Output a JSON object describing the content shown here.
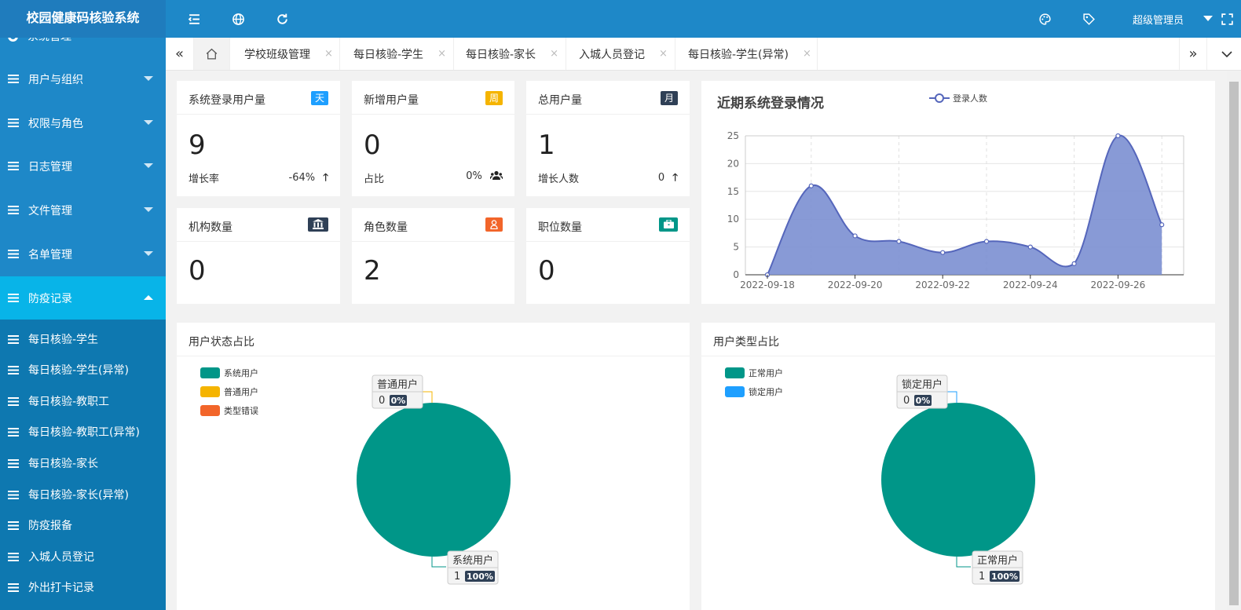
{
  "app": {
    "title": "校园健康码核验系统",
    "admin": "超级管理员"
  },
  "topbar_icons": [
    "menu-fold-icon",
    "globe-icon",
    "refresh-icon",
    "palette-icon",
    "tag-icon",
    "fullscreen-icon"
  ],
  "sidebar": {
    "partial_top": "系统管理",
    "items": [
      {
        "label": "用户与组织"
      },
      {
        "label": "权限与角色"
      },
      {
        "label": "日志管理"
      },
      {
        "label": "文件管理"
      },
      {
        "label": "名单管理"
      },
      {
        "label": "防疫记录",
        "active": true
      }
    ],
    "subitems": [
      {
        "label": "每日核验-学生"
      },
      {
        "label": "每日核验-学生(异常)"
      },
      {
        "label": "每日核验-教职工"
      },
      {
        "label": "每日核验-教职工(异常)"
      },
      {
        "label": "每日核验-家长"
      },
      {
        "label": "每日核验-家长(异常)"
      },
      {
        "label": "防疫报备"
      },
      {
        "label": "入城人员登记"
      },
      {
        "label": "外出打卡记录"
      }
    ]
  },
  "tabs": [
    {
      "label": "学校班级管理"
    },
    {
      "label": "每日核验-学生"
    },
    {
      "label": "每日核验-家长"
    },
    {
      "label": "入城人员登记"
    },
    {
      "label": "每日核验-学生(异常)"
    }
  ],
  "tab_close": "×",
  "stats": [
    {
      "title": "系统登录用户量",
      "badge": "天",
      "badge_color": "#1e9fff",
      "value": "9",
      "foot_label": "增长率",
      "foot_value": "-64%",
      "foot_icon": "arrow-up-icon"
    },
    {
      "title": "新增用户量",
      "badge": "周",
      "badge_color": "#f5b400",
      "value": "0",
      "foot_label": "占比",
      "foot_value": "0%",
      "foot_icon": "users-icon"
    },
    {
      "title": "总用户量",
      "badge": "月",
      "badge_color": "#2f4056",
      "value": "1",
      "foot_label": "增长人数",
      "foot_value": "0",
      "foot_icon": "arrow-up-icon"
    },
    {
      "title": "机构数量",
      "badge_icon": "bank-icon",
      "badge_color": "#2f4056",
      "value": "0"
    },
    {
      "title": "角色数量",
      "badge_icon": "user-icon",
      "badge_color": "#f2652a",
      "value": "2"
    },
    {
      "title": "职位数量",
      "badge_icon": "briefcase-icon",
      "badge_color": "#009688",
      "value": "0"
    }
  ],
  "colors": {
    "topbar": "#1e88c8",
    "sidebar_active": "#08b4e8",
    "teal": "#009688",
    "area": "#7b8fd1",
    "line": "#5566bb"
  },
  "line_chart": {
    "title": "近期系统登录情况",
    "chart_data": {
      "type": "area",
      "series": [
        {
          "name": "登录人数",
          "x": [
            "2022-09-18",
            "2022-09-19",
            "2022-09-20",
            "2022-09-21",
            "2022-09-22",
            "2022-09-23",
            "2022-09-24",
            "2022-09-25",
            "2022-09-26",
            "2022-09-27"
          ],
          "values": [
            0,
            16,
            7,
            6,
            4,
            6,
            5,
            2,
            25,
            9
          ]
        }
      ],
      "xticks": [
        "2022-09-18",
        "2022-09-20",
        "2022-09-22",
        "2022-09-24",
        "2022-09-26"
      ],
      "yticks": [
        0,
        5,
        10,
        15,
        20,
        25
      ],
      "ylim": [
        0,
        25
      ],
      "legend_position": "top",
      "grid": true
    }
  },
  "pie1": {
    "title": "用户状态占比",
    "chart_data": {
      "type": "pie",
      "categories": [
        "系统用户",
        "普通用户",
        "类型错误"
      ],
      "values": [
        1,
        0,
        0
      ],
      "colors": [
        "#009688",
        "#f5b400",
        "#f2652a"
      ]
    },
    "labels": [
      {
        "name": "普通用户",
        "count": "0",
        "pct": "0%"
      },
      {
        "name": "系统用户",
        "count": "1",
        "pct": "100%"
      }
    ]
  },
  "pie2": {
    "title": "用户类型占比",
    "chart_data": {
      "type": "pie",
      "categories": [
        "正常用户",
        "锁定用户"
      ],
      "values": [
        1,
        0
      ],
      "colors": [
        "#009688",
        "#1e9fff"
      ]
    },
    "labels": [
      {
        "name": "锁定用户",
        "count": "0",
        "pct": "0%"
      },
      {
        "name": "正常用户",
        "count": "1",
        "pct": "100%"
      }
    ]
  }
}
